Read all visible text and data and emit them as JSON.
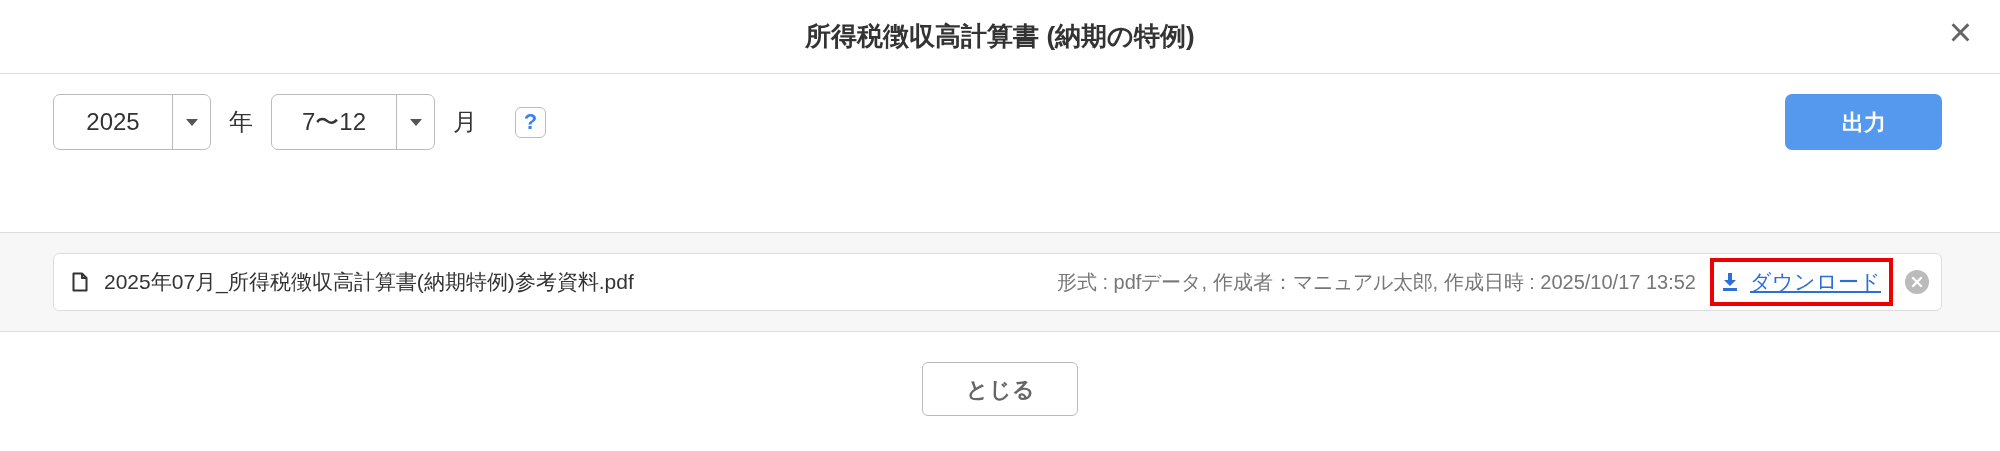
{
  "dialog": {
    "title": "所得税徴収高計算書 (納期の特例)",
    "close": "×"
  },
  "filters": [
    {
      "kind": "select",
      "value": "2025"
    },
    {
      "kind": "unit",
      "text": "年"
    },
    {
      "kind": "select",
      "value": "7〜12"
    },
    {
      "kind": "unit",
      "text": "月"
    },
    {
      "kind": "help",
      "text": "?"
    }
  ],
  "output_button": "出力",
  "files": [
    {
      "name": "2025年07月_所得税徴収高計算書(納期特例)参考資料.pdf",
      "meta": "形式 : pdfデータ, 作成者：マニュアル太郎, 作成日時 : 2025/10/17 13:52",
      "download": "ダウンロード",
      "highlighted": true
    }
  ],
  "footer_button": "とじる"
}
